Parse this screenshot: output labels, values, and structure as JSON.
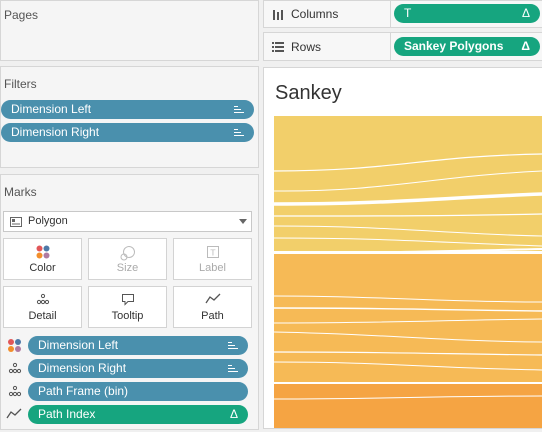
{
  "pages": {
    "title": "Pages"
  },
  "filters": {
    "title": "Filters",
    "items": [
      {
        "label": "Dimension Left"
      },
      {
        "label": "Dimension Right"
      }
    ]
  },
  "marks": {
    "title": "Marks",
    "mark_type": "Polygon",
    "cards": [
      {
        "label": "Color"
      },
      {
        "label": "Size"
      },
      {
        "label": "Label"
      },
      {
        "label": "Detail"
      },
      {
        "label": "Tooltip"
      },
      {
        "label": "Path"
      }
    ],
    "fields": [
      {
        "label": "Dimension Left",
        "type": "color",
        "pill": "blue"
      },
      {
        "label": "Dimension Right",
        "type": "detail",
        "pill": "blue"
      },
      {
        "label": "Path Frame (bin)",
        "type": "detail",
        "pill": "blue"
      },
      {
        "label": "Path Index",
        "type": "path",
        "pill": "green"
      }
    ]
  },
  "shelves": {
    "columns": {
      "label": "Columns",
      "pill": "T"
    },
    "rows": {
      "label": "Rows",
      "pill": "Sankey Polygons"
    }
  },
  "view": {
    "title": "Sankey",
    "colors": [
      "#f2d06b",
      "#f6bb56",
      "#f5a544"
    ]
  },
  "icons": {
    "columns": "columns-icon",
    "rows": "rows-icon",
    "sort": "sort-descending-icon",
    "delta": "delta-icon",
    "polygon": "polygon-mark-icon",
    "dropdown": "chevron-down-icon"
  }
}
